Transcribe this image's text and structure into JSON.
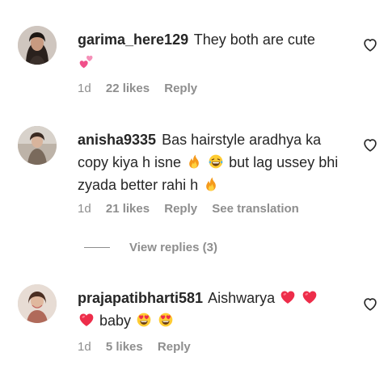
{
  "comments": [
    {
      "username": "garima_here129",
      "text": "They both are cute",
      "emojis": [
        "two-hearts-emoji"
      ],
      "age": "1d",
      "likes": "22 likes",
      "reply": "Reply"
    },
    {
      "username": "anisha9335",
      "text_a": "Bas hairstyle aradhya ka copy kiya h isne",
      "text_b": "but lag ussey bhi zyada better rahi h",
      "emojis": [
        "fire-emoji",
        "laughing-emoji",
        "fire-emoji"
      ],
      "age": "1d",
      "likes": "21 likes",
      "reply": "Reply",
      "translation": "See translation",
      "view_replies": "View replies (3)"
    },
    {
      "username": "prajapatibharti581",
      "text_a": "Aishwarya",
      "text_b": "baby",
      "emojis": [
        "red-heart-emoji",
        "red-heart-emoji",
        "red-heart-emoji",
        "heart-eyes-emoji",
        "heart-eyes-emoji"
      ],
      "age": "1d",
      "likes": "5 likes",
      "reply": "Reply"
    }
  ],
  "colors": {
    "text": "#262626",
    "meta": "#8e8e8e",
    "heart_red": "#ed2d4a"
  }
}
